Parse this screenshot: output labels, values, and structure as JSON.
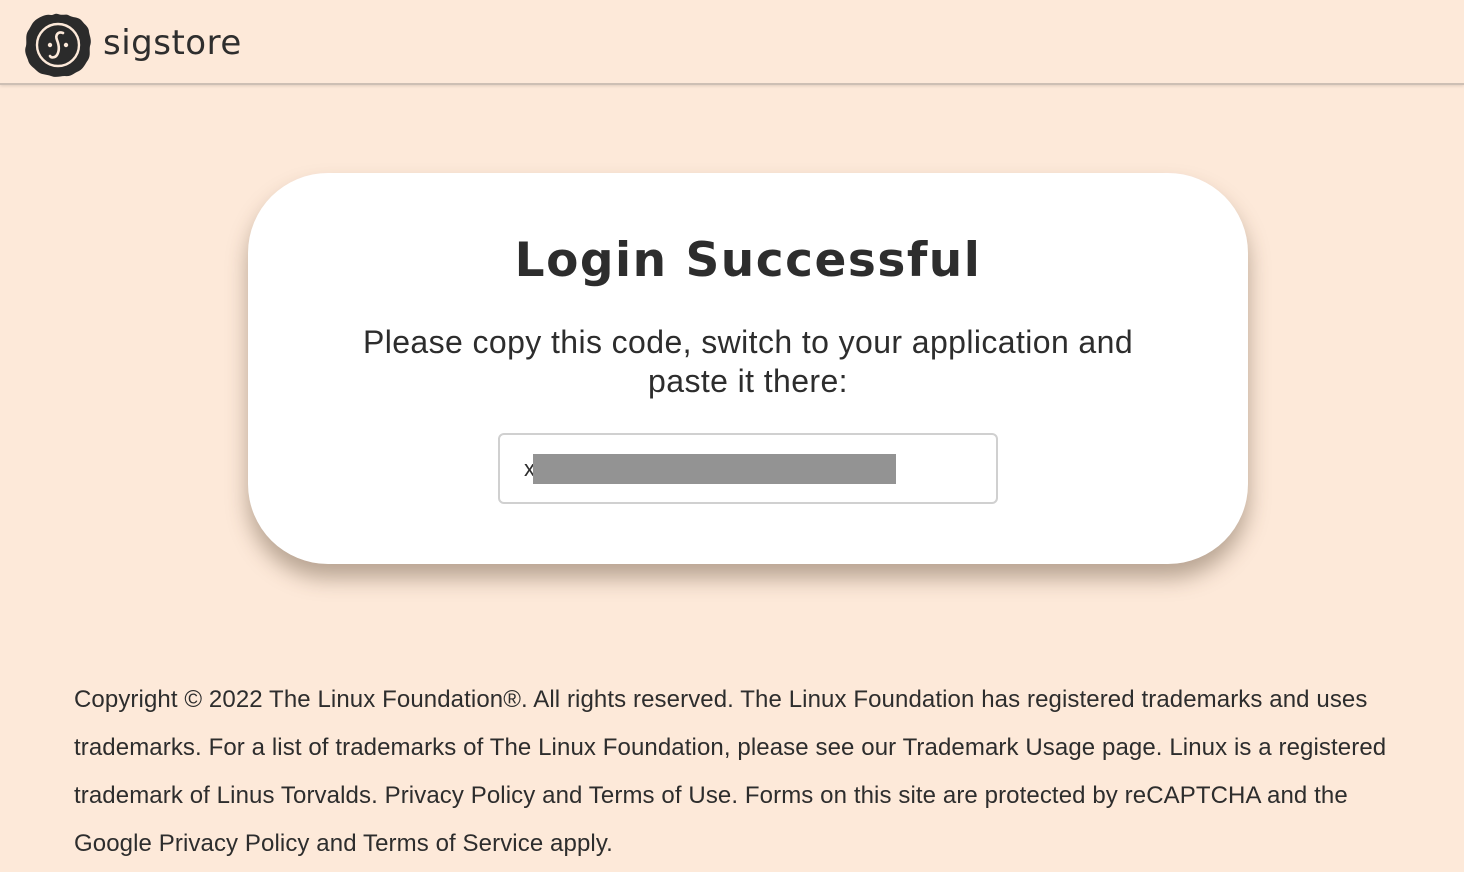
{
  "header": {
    "brand_name": "sigstore",
    "logo_icon": "sigstore-seal-icon"
  },
  "card": {
    "title": "Login Successful",
    "instructions": "Please copy this code, switch to your application and paste it there:",
    "code_value": "x                                               o"
  },
  "footer": {
    "copyright": "Copyright © 2022 The Linux Foundation®. All rights reserved. The Linux Foundation has registered trademarks and uses trademarks. For a list of trademarks of The Linux Foundation, please see our Trademark Usage page. Linux is a registered trademark of Linus Torvalds. Privacy Policy and Terms of Use. Forms on this site are protected by reCAPTCHA and the Google Privacy Policy and Terms of Service apply."
  },
  "colors": {
    "page_background": "#fde9d9",
    "card_background": "#ffffff",
    "text": "#2d2d2d",
    "redaction": "#939393"
  }
}
